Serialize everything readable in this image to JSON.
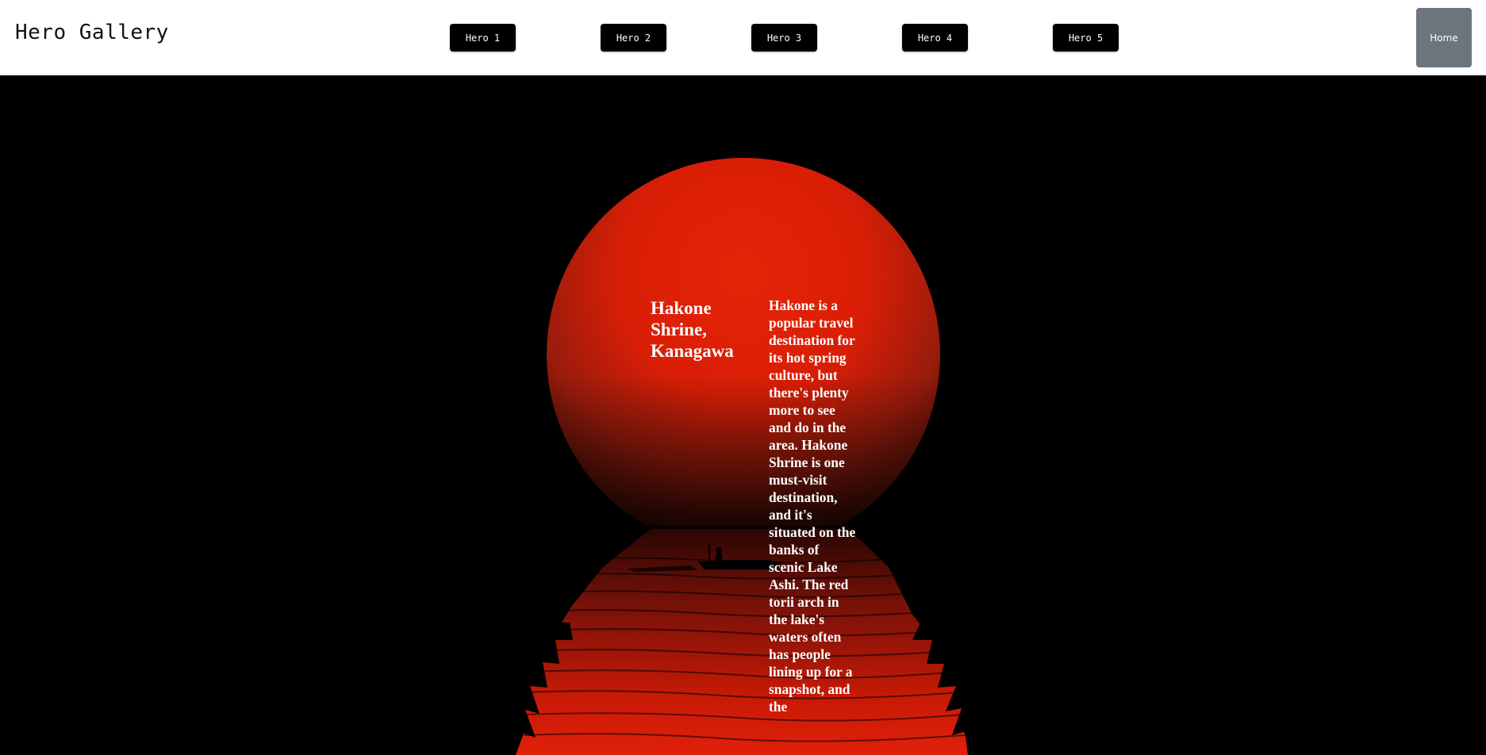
{
  "header": {
    "brand": "Hero Gallery",
    "nav": [
      {
        "label": "Hero 1"
      },
      {
        "label": "Hero 2"
      },
      {
        "label": "Hero 3"
      },
      {
        "label": "Hero 4"
      },
      {
        "label": "Hero 5"
      }
    ],
    "home_label": "Home"
  },
  "hero": {
    "title": "Hakone Shrine, Kanagawa",
    "description": "Hakone is a popular travel destination for its hot spring culture, but there's plenty more to see and do in the area. Hakone Shrine is one must-visit destination, and it's situated on the banks of scenic Lake Ashi. The red torii arch in the lake's waters often has people lining up for a snapshot, and the",
    "image_subject": "red sun over lake with fishing boat silhouette"
  },
  "colors": {
    "header_bg": "#ffffff",
    "nav_button_bg": "#000000",
    "home_button_bg": "#6c757d",
    "hero_bg": "#000000",
    "sun_red": "#e02007"
  }
}
